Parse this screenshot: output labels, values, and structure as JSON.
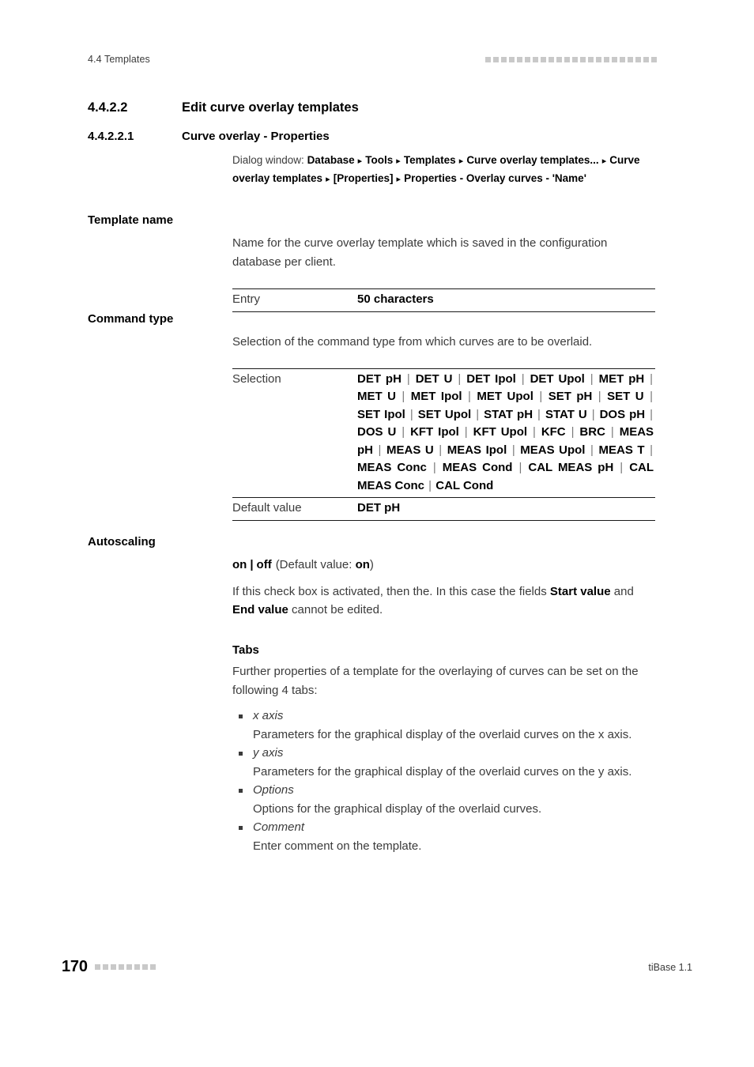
{
  "running_head": {
    "text": "4.4 Templates",
    "marker_count": 22
  },
  "headings": {
    "section": {
      "number": "4.4.2.2",
      "title": "Edit curve overlay templates"
    },
    "subsection": {
      "number": "4.4.2.2.1",
      "title": "Curve overlay - Properties"
    }
  },
  "dialog_path": {
    "label": "Dialog window:",
    "steps": [
      "Database",
      "Tools",
      "Templates",
      "Curve overlay templates...",
      "Curve overlay templates",
      "[Properties]",
      "Properties - Overlay curves - 'Name'"
    ]
  },
  "template_name": {
    "label": "Template name",
    "description": "Name for the curve overlay template which is saved in the configuration database per client.",
    "table": [
      {
        "key": "Entry",
        "value": "50 characters"
      }
    ]
  },
  "command_type": {
    "label": "Command type",
    "description": "Selection of the command type from which curves are to be overlaid.",
    "selection_label": "Selection",
    "selection_options": [
      "DET pH",
      "DET U",
      "DET Ipol",
      "DET Upol",
      "MET pH",
      "MET U",
      "MET Ipol",
      "MET Upol",
      "SET pH",
      "SET U",
      "SET Ipol",
      "SET Upol",
      "STAT pH",
      "STAT U",
      "DOS pH",
      "DOS U",
      "KFT Ipol",
      "KFT Upol",
      "KFC",
      "BRC",
      "MEAS pH",
      "MEAS U",
      "MEAS Ipol",
      "MEAS Upol",
      "MEAS T",
      "MEAS Conc",
      "MEAS Cond",
      "CAL MEAS pH",
      "CAL MEAS Conc",
      "CAL Cond"
    ],
    "default_label": "Default value",
    "default_value": "DET pH"
  },
  "autoscaling": {
    "label": "Autoscaling",
    "values_on": "on",
    "values_sep": "|",
    "values_off": "off",
    "default_prefix": "(Default value: ",
    "default_value": "on",
    "default_suffix": ")",
    "description_part1": "If this check box is activated, then the. In this case the fields ",
    "description_bold1": "Start value",
    "description_part2": " and ",
    "description_bold2": "End value",
    "description_part3": " cannot be edited."
  },
  "tabs": {
    "heading": "Tabs",
    "intro": "Further properties of a template for the overlaying of curves can be set on the following 4 tabs:",
    "items": [
      {
        "name": "x axis",
        "description": "Parameters for the graphical display of the overlaid curves on the x axis."
      },
      {
        "name": "y axis",
        "description": "Parameters for the graphical display of the overlaid curves on the y axis."
      },
      {
        "name": "Options",
        "description": "Options for the graphical display of the overlaid curves."
      },
      {
        "name": "Comment",
        "description": "Enter comment on the template."
      }
    ]
  },
  "footer": {
    "page_number": "170",
    "marker_count": 8,
    "product": "tiBase 1.1"
  },
  "colors": {
    "body_text": "#3b3b3b",
    "emphasis_text": "#000000",
    "marker": "#c9c9c9",
    "rule": "#1a1a1a"
  }
}
